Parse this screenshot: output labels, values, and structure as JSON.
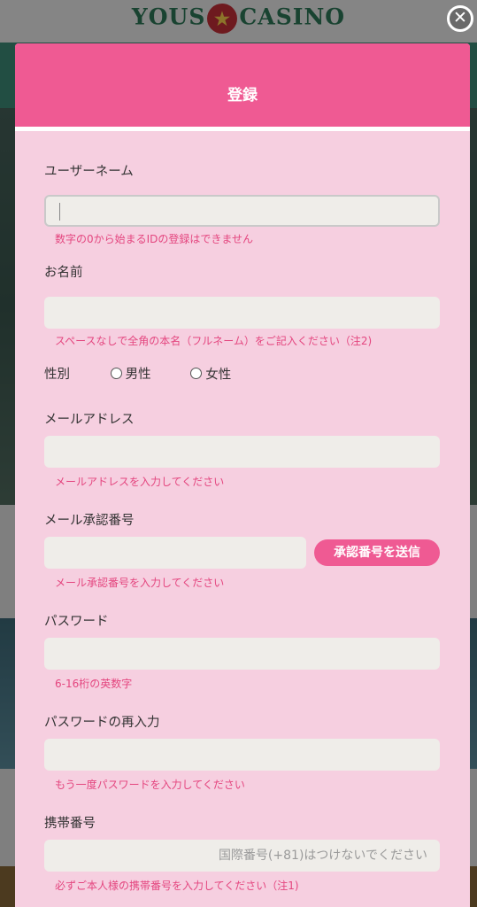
{
  "background": {
    "logo_left": "YOUS",
    "logo_right": "CASINO",
    "logo_star": "★"
  },
  "close_icon_glyph": "✕",
  "modal": {
    "title": "登録",
    "username": {
      "label": "ユーザーネーム",
      "value": "",
      "hint": "数字の0から始まるIDの登録はできません"
    },
    "fullname": {
      "label": "お名前",
      "value": "",
      "hint": "スペースなしで全角の本名（フルネーム）をご記入ください（注2)"
    },
    "gender": {
      "label": "性別",
      "options": [
        "男性",
        "女性"
      ]
    },
    "email": {
      "label": "メールアドレス",
      "value": "",
      "hint": "メールアドレスを入力してください"
    },
    "email_code": {
      "label": "メール承認番号",
      "value": "",
      "send_button": "承認番号を送信",
      "hint": "メール承認番号を入力してください"
    },
    "password": {
      "label": "パスワード",
      "value": "",
      "hint": "6-16桁の英数字"
    },
    "password_confirm": {
      "label": "パスワードの再入力",
      "value": "",
      "hint": "もう一度パスワードを入力してください"
    },
    "phone": {
      "label": "携帯番号",
      "placeholder": "国際番号(+81)はつけないでください",
      "hint": "必ずご本人様の携帯番号を入力してください（注1)"
    }
  },
  "colors": {
    "accent": "#ef5a93",
    "modal_bg": "#f6cfe0",
    "hint": "#e4467f"
  }
}
